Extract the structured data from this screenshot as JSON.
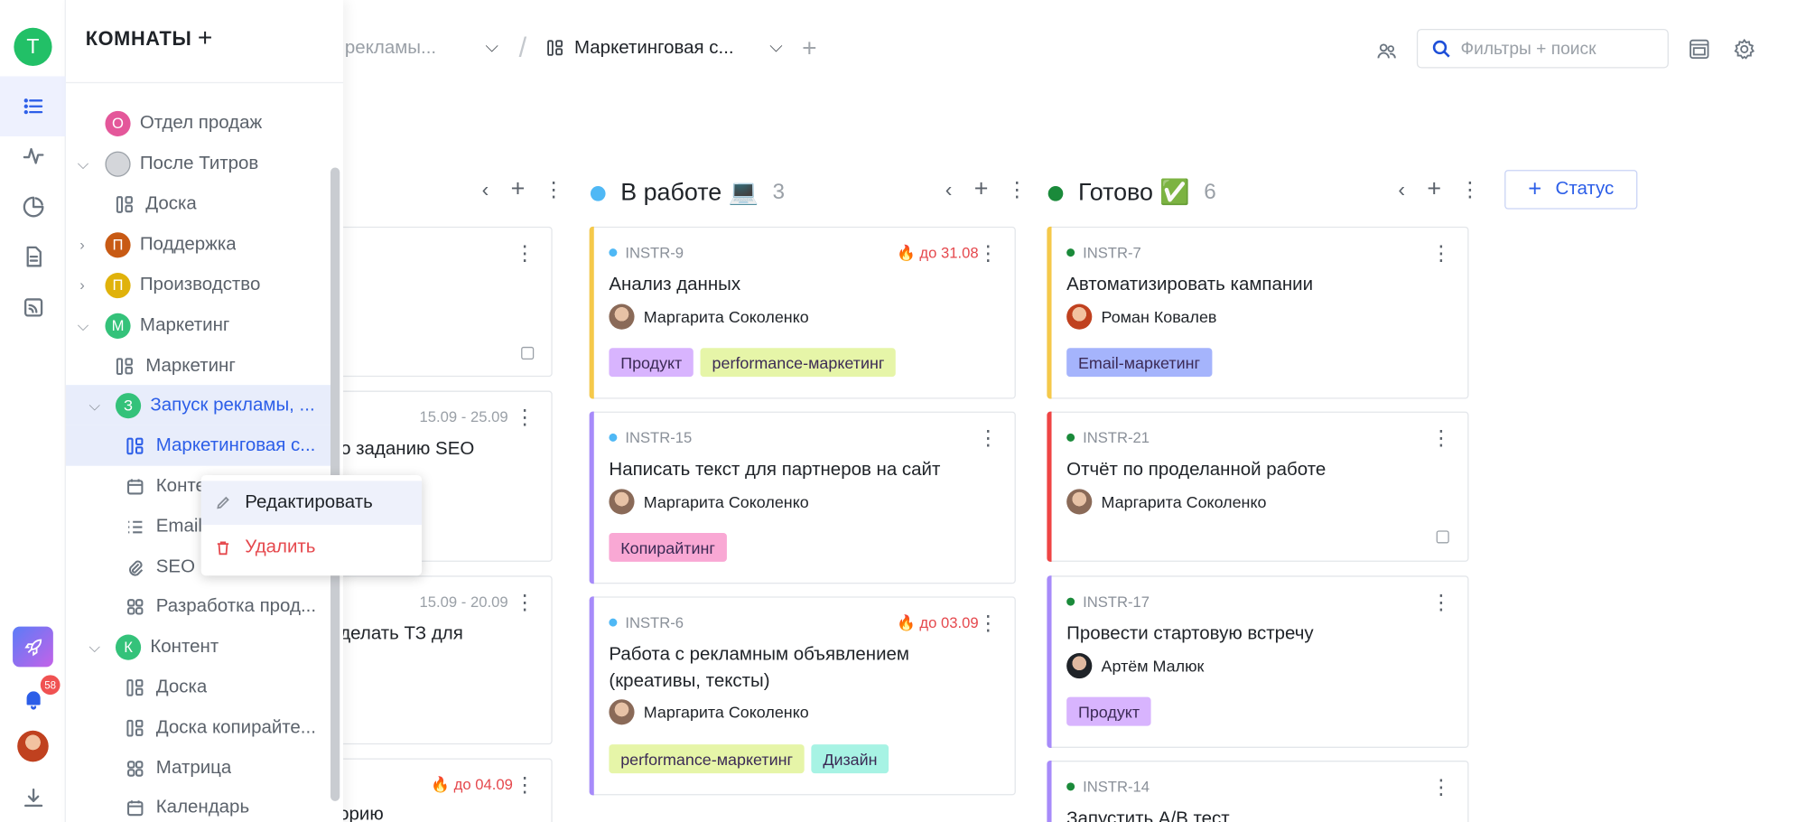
{
  "workspace": {
    "avatar_letter": "Т",
    "color": "#22c067"
  },
  "rail": {
    "notifications_count": "58"
  },
  "sidebar": {
    "title": "КОМНАТЫ",
    "add": "+",
    "items": [
      {
        "label": "Отдел продаж",
        "kind": "room",
        "letter": "О",
        "color": "#e4579a"
      },
      {
        "label": "После Титров",
        "kind": "room-img"
      },
      {
        "label": "Доска",
        "kind": "board"
      },
      {
        "label": "Поддержка",
        "kind": "room",
        "letter": "П",
        "color": "#c85a14"
      },
      {
        "label": "Производство",
        "kind": "room",
        "letter": "П",
        "color": "#e0b20b"
      },
      {
        "label": "Маркетинг",
        "kind": "room",
        "letter": "М",
        "color": "#34c27a"
      },
      {
        "label": "Маркетинг",
        "kind": "board"
      },
      {
        "label": "Запуск рекламы, ...",
        "kind": "room",
        "letter": "З",
        "color": "#34c27a"
      },
      {
        "label": "Маркетинговая с...",
        "kind": "board"
      },
      {
        "label": "Конте",
        "kind": "calendar"
      },
      {
        "label": "Email",
        "kind": "list"
      },
      {
        "label": "SEO",
        "kind": "clip"
      },
      {
        "label": "Разработка прод...",
        "kind": "matrix"
      },
      {
        "label": "Контент",
        "kind": "room",
        "letter": "К",
        "color": "#34c27a"
      },
      {
        "label": "Доска",
        "kind": "board"
      },
      {
        "label": "Доска копирайте...",
        "kind": "board"
      },
      {
        "label": "Матрица",
        "kind": "matrix"
      },
      {
        "label": "Календарь",
        "kind": "calendar"
      }
    ]
  },
  "context_menu": {
    "edit": "Редактировать",
    "delete": "Удалить"
  },
  "topbar": {
    "crumb1": "к рекламы...",
    "crumb_sep": "/",
    "crumb2": "Маркетинговая с...",
    "add": "+",
    "search_placeholder": "Фильтры + поиск"
  },
  "columns": [
    {
      "title": "В работе 💻",
      "count": "3",
      "color": "#4fb8f5"
    },
    {
      "title": "Готово ✅",
      "count": "6",
      "color": "#1a8a3a"
    }
  ],
  "status_button": {
    "plus": "+",
    "label": "Статус"
  },
  "partial_cards": [
    {
      "dates": "15.09 - 25.09",
      "title": "по заданию SEO"
    },
    {
      "dates": "15.09 - 20.09",
      "title": "сделать ТЗ для"
    },
    {
      "due": "до 04.09",
      "title": "торию"
    }
  ],
  "cards_in_progress": [
    {
      "id": "INSTR-9",
      "due": "до 31.08",
      "title": "Анализ данных",
      "user": "Маргарита Соколенко",
      "tags": [
        "Продукт",
        "performance-маркетинг"
      ],
      "bar": "#f5c94a"
    },
    {
      "id": "INSTR-15",
      "title": "Написать текст для партнеров на сайт",
      "user": "Маргарита Соколенко",
      "tags": [
        "Копирайтинг"
      ],
      "bar": "#a78bfa"
    },
    {
      "id": "INSTR-6",
      "due": "до 03.09",
      "title": "Работа с рекламным объявлением (креативы, тексты)",
      "user": "Маргарита Соколенко",
      "tags": [
        "performance-маркетинг",
        "Дизайн"
      ],
      "bar": "#a78bfa"
    }
  ],
  "cards_done": [
    {
      "id": "INSTR-7",
      "title": "Автоматизировать кампании",
      "user": "Роман Ковалев",
      "tags": [
        "Email-маркетинг"
      ],
      "bar": "#f5c94a"
    },
    {
      "id": "INSTR-21",
      "title": "Отчёт по проделанной работе",
      "user": "Маргарита Соколенко",
      "tags": [],
      "bar": "#ef4444"
    },
    {
      "id": "INSTR-17",
      "title": "Провести стартовую встречу",
      "user": "Артём Малюк",
      "tags": [
        "Продукт"
      ],
      "bar": "#a78bfa"
    },
    {
      "id": "INSTR-14",
      "title": "Запустить А/В тест",
      "user": "",
      "tags": [],
      "bar": "#a78bfa"
    }
  ],
  "tag_colors": {
    "Продукт": "#d8b4fe",
    "performance-маркетинг": "#e6f5a8",
    "Копирайтинг": "#f9a8d4",
    "Дизайн": "#a7f3e4",
    "Email-маркетинг": "#a5b4fc"
  }
}
